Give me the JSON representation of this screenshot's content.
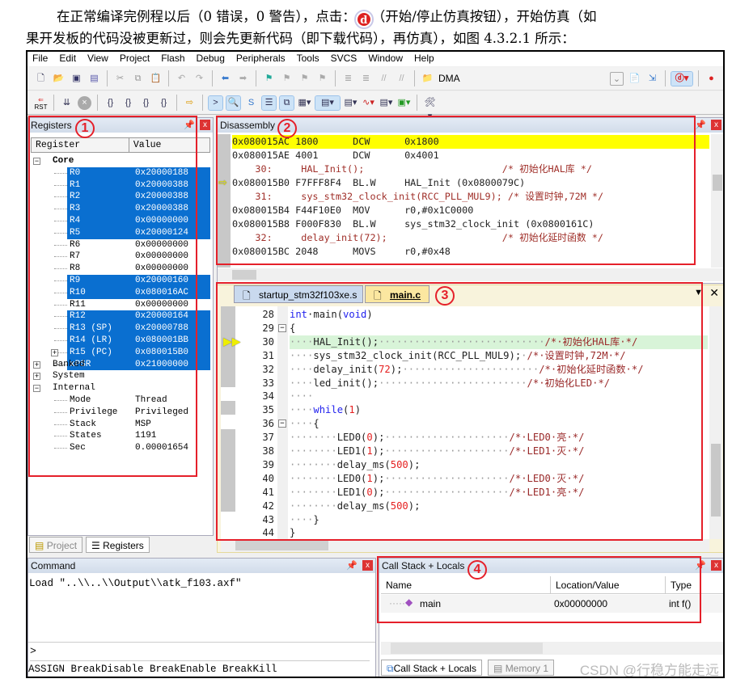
{
  "paragraph": {
    "line1_before": "在正常编译完例程以后（0 错误，0 警告），点击：",
    "icon": "debug-start-icon",
    "line1_after": "（开始/停止仿真按钮），开始仿真（如",
    "line2": "果开发板的代码没被更新过，则会先更新代码（即下载代码），再仿真），如图 4.3.2.1 所示："
  },
  "menu": [
    "File",
    "Edit",
    "View",
    "Project",
    "Flash",
    "Debug",
    "Peripherals",
    "Tools",
    "SVCS",
    "Window",
    "Help"
  ],
  "toolbar": {
    "dma_label": "DMA",
    "rst_label": "RST"
  },
  "registers": {
    "title": "Registers",
    "col_register": "Register",
    "col_value": "Value",
    "core_label": "Core",
    "core": [
      {
        "name": "R0",
        "value": "0x20000188",
        "sel": true
      },
      {
        "name": "R1",
        "value": "0x20000388",
        "sel": true
      },
      {
        "name": "R2",
        "value": "0x20000388",
        "sel": true
      },
      {
        "name": "R3",
        "value": "0x20000388",
        "sel": true
      },
      {
        "name": "R4",
        "value": "0x00000000",
        "sel": true
      },
      {
        "name": "R5",
        "value": "0x20000124",
        "sel": true
      },
      {
        "name": "R6",
        "value": "0x00000000",
        "sel": false
      },
      {
        "name": "R7",
        "value": "0x00000000",
        "sel": false
      },
      {
        "name": "R8",
        "value": "0x00000000",
        "sel": false
      },
      {
        "name": "R9",
        "value": "0x20000160",
        "sel": true
      },
      {
        "name": "R10",
        "value": "0x080016AC",
        "sel": true
      },
      {
        "name": "R11",
        "value": "0x00000000",
        "sel": false
      },
      {
        "name": "R12",
        "value": "0x20000164",
        "sel": true
      },
      {
        "name": "R13 (SP)",
        "value": "0x20000788",
        "sel": true
      },
      {
        "name": "R14 (LR)",
        "value": "0x080001BB",
        "sel": true
      },
      {
        "name": "R15 (PC)",
        "value": "0x080015B0",
        "sel": true
      },
      {
        "name": "xPSR",
        "value": "0x21000000",
        "sel": true
      }
    ],
    "groups": [
      "Banked",
      "System",
      "Internal"
    ],
    "internal": [
      {
        "name": "Mode",
        "value": "Thread"
      },
      {
        "name": "Privilege",
        "value": "Privileged"
      },
      {
        "name": "Stack",
        "value": "MSP"
      },
      {
        "name": "States",
        "value": "1191"
      },
      {
        "name": "Sec",
        "value": "0.00001654"
      }
    ],
    "tabs": [
      "Project",
      "Registers"
    ]
  },
  "disassembly": {
    "title": "Disassembly",
    "rows": [
      {
        "text": "0x080015AC 1800      DCW      0x1800",
        "kind": "cur"
      },
      {
        "text": "0x080015AE 4001      DCW      0x4001",
        "kind": "asm"
      },
      {
        "text": "    30:     HAL_Init();                        /* 初始化HAL库 */",
        "kind": "src"
      },
      {
        "text": "0x080015B0 F7FFF8F4  BL.W     HAL_Init (0x0800079C)",
        "kind": "asm",
        "arrow": true
      },
      {
        "text": "    31:     sys_stm32_clock_init(RCC_PLL_MUL9); /* 设置时钟,72M */",
        "kind": "src"
      },
      {
        "text": "0x080015B4 F44F10E0  MOV      r0,#0x1C0000",
        "kind": "asm"
      },
      {
        "text": "0x080015B8 F000F830  BL.W     sys_stm32_clock_init (0x0800161C)",
        "kind": "asm"
      },
      {
        "text": "    32:     delay_init(72);                    /* 初始化延时函数 */",
        "kind": "src"
      },
      {
        "text": "0x080015BC 2048      MOVS     r0,#0x48",
        "kind": "asm"
      }
    ]
  },
  "editor": {
    "tabs": [
      "startup_stm32f103xe.s",
      "main.c"
    ],
    "active_tab": "main.c",
    "lines": [
      {
        "n": "28",
        "seg": [
          [
            "int",
            "kw"
          ],
          [
            "·main(",
            ""
          ],
          [
            "void",
            "kw"
          ],
          [
            ")",
            ""
          ]
        ]
      },
      {
        "n": "29",
        "seg": [
          [
            "{",
            ""
          ]
        ]
      },
      {
        "n": "30",
        "hl": true,
        "seg": [
          [
            "····",
            "dot"
          ],
          [
            "HAL_Init();",
            ""
          ],
          [
            "····························",
            "dot"
          ],
          [
            "/*·初始化HAL库·*/",
            "cm"
          ]
        ]
      },
      {
        "n": "31",
        "seg": [
          [
            "····",
            "dot"
          ],
          [
            "sys_stm32_clock_init(RCC_PLL_MUL9);",
            ""
          ],
          [
            "·",
            "dot"
          ],
          [
            "/*·设置时钟,72M·*/",
            "cm"
          ]
        ]
      },
      {
        "n": "32",
        "seg": [
          [
            "····",
            "dot"
          ],
          [
            "delay_init(",
            ""
          ],
          [
            "72",
            "num"
          ],
          [
            ");",
            ""
          ],
          [
            "·······················",
            "dot"
          ],
          [
            "/*·初始化延时函数·*/",
            "cm"
          ]
        ]
      },
      {
        "n": "33",
        "seg": [
          [
            "····",
            "dot"
          ],
          [
            "led_init();",
            ""
          ],
          [
            "·························",
            "dot"
          ],
          [
            "/*·初始化LED·*/",
            "cm"
          ]
        ]
      },
      {
        "n": "34",
        "seg": [
          [
            "····",
            "dot"
          ]
        ]
      },
      {
        "n": "35",
        "seg": [
          [
            "····",
            "dot"
          ],
          [
            "while",
            "kw"
          ],
          [
            "(",
            ""
          ],
          [
            "1",
            "num"
          ],
          [
            ")",
            ""
          ]
        ]
      },
      {
        "n": "36",
        "seg": [
          [
            "····",
            "dot"
          ],
          [
            "{",
            ""
          ]
        ]
      },
      {
        "n": "37",
        "seg": [
          [
            "········",
            "dot"
          ],
          [
            "LED0(",
            ""
          ],
          [
            "0",
            "num"
          ],
          [
            ");",
            ""
          ],
          [
            "·····················",
            "dot"
          ],
          [
            "/*·LED0·亮·*/",
            "cm"
          ]
        ]
      },
      {
        "n": "38",
        "seg": [
          [
            "········",
            "dot"
          ],
          [
            "LED1(",
            ""
          ],
          [
            "1",
            "num"
          ],
          [
            ");",
            ""
          ],
          [
            "·····················",
            "dot"
          ],
          [
            "/*·LED1·灭·*/",
            "cm"
          ]
        ]
      },
      {
        "n": "39",
        "seg": [
          [
            "········",
            "dot"
          ],
          [
            "delay_ms(",
            ""
          ],
          [
            "500",
            "num"
          ],
          [
            ");",
            ""
          ]
        ]
      },
      {
        "n": "40",
        "seg": [
          [
            "········",
            "dot"
          ],
          [
            "LED0(",
            ""
          ],
          [
            "1",
            "num"
          ],
          [
            ");",
            ""
          ],
          [
            "·····················",
            "dot"
          ],
          [
            "/*·LED0·灭·*/",
            "cm"
          ]
        ]
      },
      {
        "n": "41",
        "seg": [
          [
            "········",
            "dot"
          ],
          [
            "LED1(",
            ""
          ],
          [
            "0",
            "num"
          ],
          [
            ");",
            ""
          ],
          [
            "·····················",
            "dot"
          ],
          [
            "/*·LED1·亮·*/",
            "cm"
          ]
        ]
      },
      {
        "n": "42",
        "seg": [
          [
            "········",
            "dot"
          ],
          [
            "delay_ms(",
            ""
          ],
          [
            "500",
            "num"
          ],
          [
            ");",
            ""
          ]
        ]
      },
      {
        "n": "43",
        "seg": [
          [
            "····",
            "dot"
          ],
          [
            "}",
            ""
          ]
        ]
      },
      {
        "n": "44",
        "seg": [
          [
            "}",
            ""
          ]
        ]
      }
    ]
  },
  "command": {
    "title": "Command",
    "output": "Load \"..\\\\..\\\\Output\\\\atk_f103.axf\"",
    "prompt": ">",
    "hint": "ASSIGN BreakDisable BreakEnable BreakKill"
  },
  "callstack": {
    "title": "Call Stack + Locals",
    "cols": [
      "Name",
      "Location/Value",
      "Type"
    ],
    "rows": [
      {
        "name": "main",
        "value": "0x00000000",
        "type": "int f()"
      }
    ],
    "tabs": [
      "Call Stack + Locals",
      "Memory 1"
    ]
  },
  "annotations": [
    "1",
    "2",
    "3",
    "4"
  ],
  "watermark": "CSDN @行稳方能走远",
  "colors": {
    "selection": "#0a6fd0",
    "current_line": "#ffff00",
    "annotation": "#e5202a",
    "keyword": "#2222ee",
    "comment": "#9a2a2a"
  }
}
